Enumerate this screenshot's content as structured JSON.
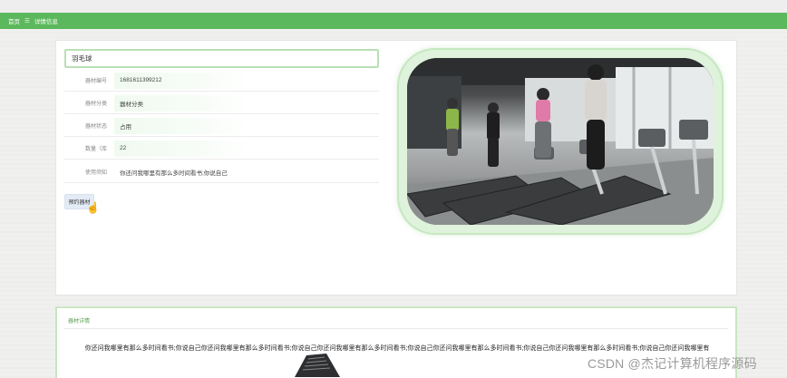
{
  "breadcrumb": {
    "home": "首页",
    "separator": "☰",
    "current": "详情信息"
  },
  "equipment": {
    "name": "羽毛球",
    "fields": [
      {
        "label": "器材编号",
        "value": "1681611399212"
      },
      {
        "label": "器材分类",
        "value": "器材分类"
      },
      {
        "label": "器材状态",
        "value": "占用"
      },
      {
        "label": "数量（库",
        "value": "22"
      },
      {
        "label": "使用须知",
        "value": "你还问我哪里有那么多时间看书;你说自己"
      }
    ],
    "reserve_label": "预约器材"
  },
  "photo": {
    "alt": "gym-treadmill-photo",
    "accent": "#c6e8c0"
  },
  "details": {
    "title": "器材详情",
    "content": "你还问我哪里有那么多时间看书;你说自己你还问我哪里有那么多时间看书;你说自己你还问我哪里有那么多时间看书;你说自己你还问我哪里有那么多时间看书;你说自己你还问我哪里有那么多时间看书;你说自己你还问我哪里有"
  },
  "watermark": "CSDN @杰记计算机程序源码",
  "colors": {
    "nav": "#5cb85c",
    "frame": "#c6e8c0",
    "button": "#e3ecf6"
  }
}
